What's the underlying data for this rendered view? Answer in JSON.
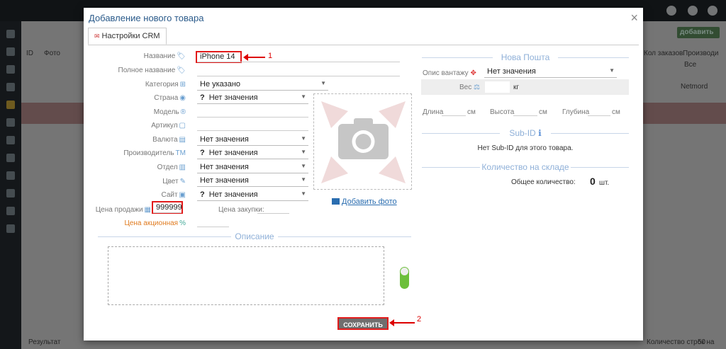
{
  "modal": {
    "title": "Добавление нового товара",
    "close": "×",
    "tab": "Настройки CRM"
  },
  "form": {
    "name_label": "Название",
    "name_value": "iPhone 14",
    "fullname_label": "Полное название",
    "category_label": "Категория",
    "category_value": "Не указано",
    "country_label": "Страна",
    "country_value": "Нет значения",
    "model_label": "Модель",
    "article_label": "Артикул",
    "currency_label": "Валюта",
    "currency_value": "Нет значения",
    "maker_label": "Производитель",
    "maker_value": "Нет значения",
    "dept_label": "Отдел",
    "dept_value": "Нет значения",
    "color_label": "Цвет",
    "color_value": "Нет значения",
    "site_label": "Сайт",
    "site_value": "Нет значения",
    "sale_price_label": "Цена продажи",
    "sale_price_value": "999999",
    "purchase_price_label": "Цена закупки:",
    "promo_price_label": "Цена акционная",
    "question_mark": "?"
  },
  "photo": {
    "add_label": "Добавить фото"
  },
  "description": {
    "heading": "Описание"
  },
  "nova_poshta": {
    "heading": "Нова Пошта",
    "cargo_label": "Опис вантажу",
    "cargo_value": "Нет значения",
    "weight_label": "Вес",
    "weight_unit": "кг",
    "length_label": "Длина",
    "height_label": "Высота",
    "depth_label": "Глубина",
    "cm": "см"
  },
  "subid": {
    "heading": "Sub-ID",
    "text": "Нет Sub-ID для этого товара."
  },
  "stock": {
    "heading": "Количество на складе",
    "total_label": "Общее количество:",
    "total_value": "0",
    "unit": "шт."
  },
  "annotations": {
    "first": "1",
    "second": "2"
  },
  "save_label": "СОХРАНИТЬ",
  "background": {
    "add_label": "добавить",
    "col_id": "ID",
    "col_photo": "Фото",
    "col_orders": "Кол заказов",
    "col_maker": "Производи",
    "filter_all": "Все",
    "row_maker": "Netmord",
    "result_label": "Результат",
    "per_page_label": "Количество строк на",
    "per_page_value": "50"
  },
  "colors": {
    "accent": "#2a5a8a",
    "highlight": "#e21b1b",
    "save_bg": "#6f6f6f",
    "toggle": "#6cbf3b"
  }
}
